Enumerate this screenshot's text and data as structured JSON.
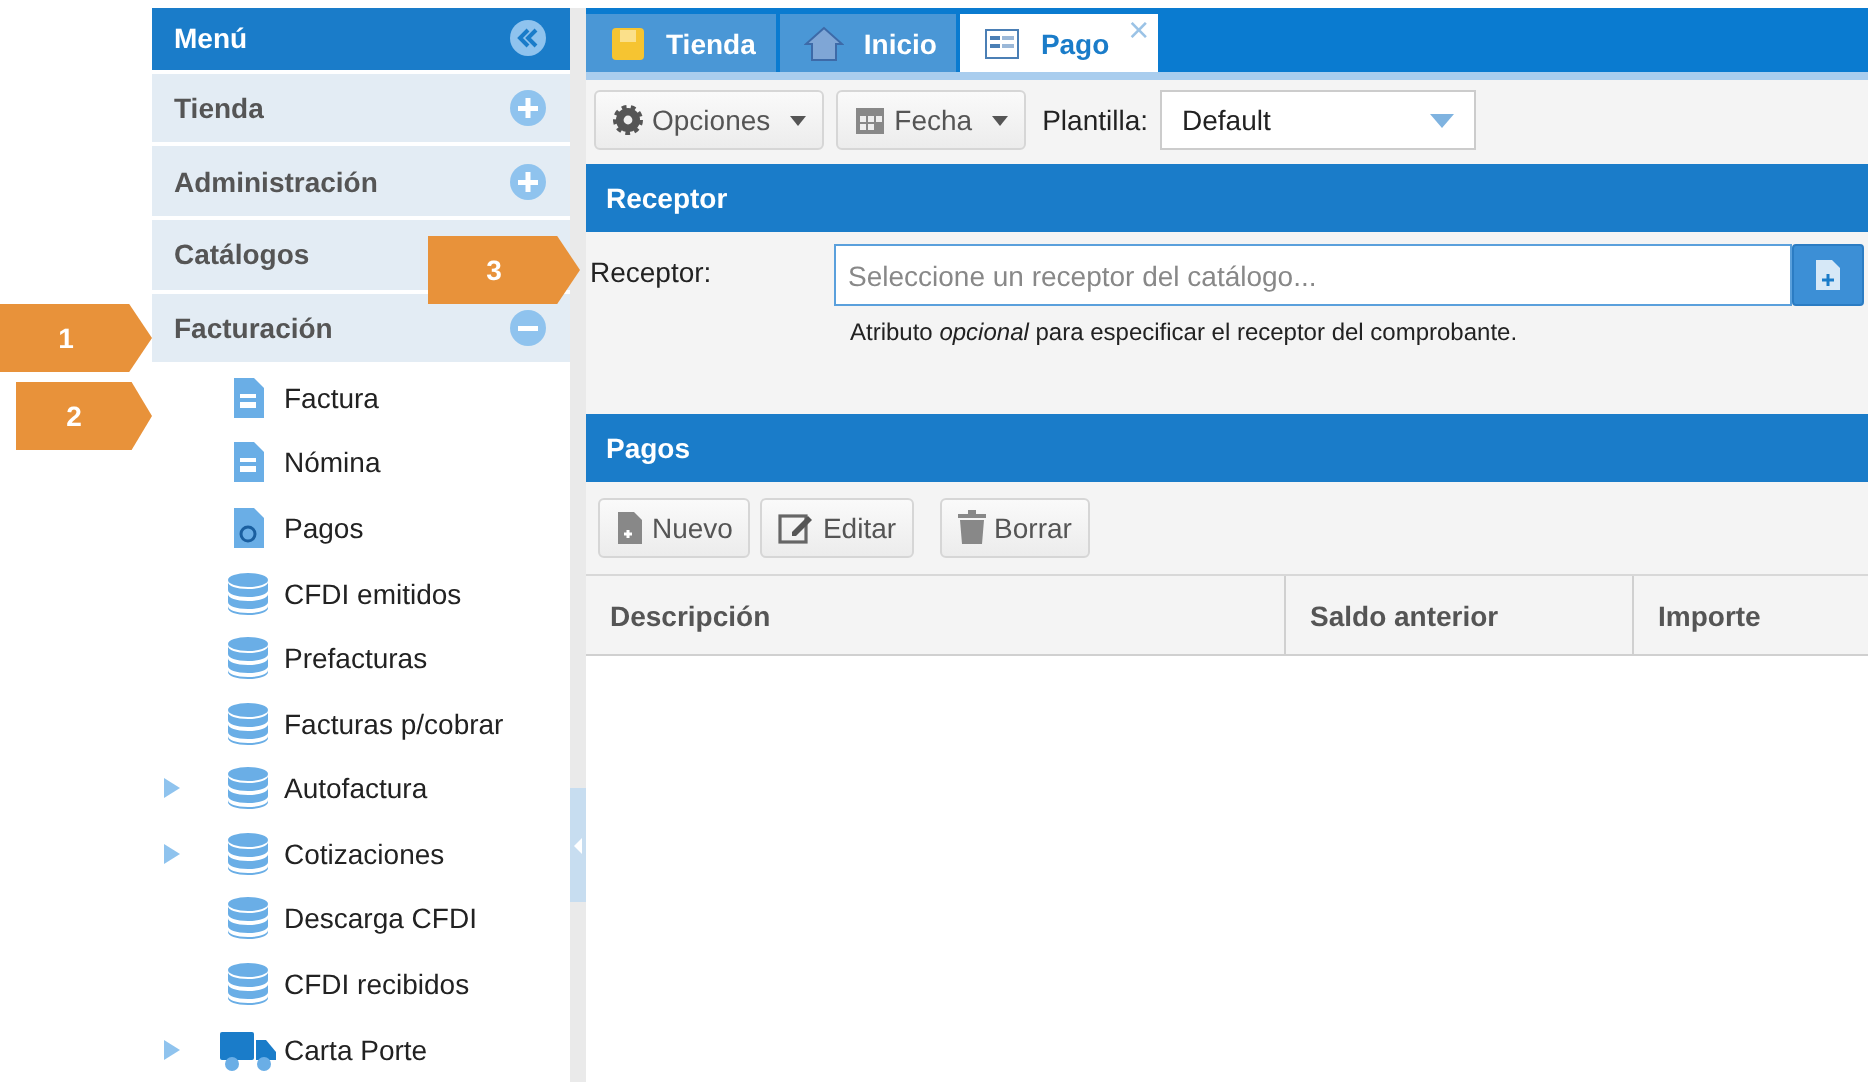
{
  "sidebar": {
    "title": "Menú",
    "sections": [
      {
        "label": "Tienda",
        "expanded": false
      },
      {
        "label": "Administración",
        "expanded": false
      },
      {
        "label": "Catálogos"
      },
      {
        "label": "Facturación",
        "expanded": true,
        "items": [
          {
            "label": "Factura",
            "kind": "document",
            "has_children": false
          },
          {
            "label": "Nómina",
            "kind": "document",
            "has_children": false
          },
          {
            "label": "Pagos",
            "kind": "payment",
            "has_children": false
          },
          {
            "label": "CFDI emitidos",
            "kind": "database",
            "has_children": false
          },
          {
            "label": "Prefacturas",
            "kind": "database",
            "has_children": false
          },
          {
            "label": "Facturas p/cobrar",
            "kind": "database",
            "has_children": false
          },
          {
            "label": "Autofactura",
            "kind": "database",
            "has_children": true
          },
          {
            "label": "Cotizaciones",
            "kind": "database",
            "has_children": true
          },
          {
            "label": "Descarga CFDI",
            "kind": "database",
            "has_children": false
          },
          {
            "label": "CFDI recibidos",
            "kind": "database",
            "has_children": false
          },
          {
            "label": "Carta Porte",
            "kind": "truck",
            "has_children": true
          }
        ]
      }
    ]
  },
  "tabs": [
    {
      "label": "Tienda",
      "kind": "note",
      "selected": false
    },
    {
      "label": "Inicio",
      "kind": "house",
      "selected": false
    },
    {
      "label": "Pago",
      "kind": "form",
      "selected": true,
      "close": "×"
    }
  ],
  "toolbar": {
    "buttons": [
      {
        "label": "Opciones",
        "kind": "gear"
      },
      {
        "label": "Fecha",
        "kind": "calendar"
      }
    ],
    "template": {
      "label": "Plantilla:",
      "value": "Default"
    }
  },
  "receptor": {
    "title": "Receptor",
    "label": "Receptor:",
    "placeholder": "Seleccione un receptor del catálogo...",
    "hint": "Atributo *opcional* para especificar el receptor del comprobante."
  },
  "pagos": {
    "title": "Pagos",
    "buttons": [
      {
        "label": "Nuevo",
        "kind": "new"
      },
      {
        "label": "Editar",
        "kind": "edit"
      },
      {
        "label": "Borrar",
        "kind": "trash"
      }
    ],
    "columns": [
      "Descripción",
      "Saldo anterior",
      "Importe"
    ]
  },
  "callouts": [
    "1",
    "2",
    "3"
  ]
}
